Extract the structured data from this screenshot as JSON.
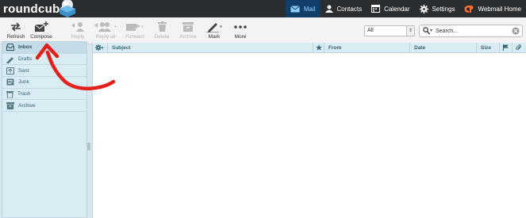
{
  "app": {
    "logo_text": "roundcube"
  },
  "topnav": {
    "items": [
      {
        "label": "Mail",
        "icon": "mail-icon"
      },
      {
        "label": "Contacts",
        "icon": "contacts-icon"
      },
      {
        "label": "Calendar",
        "icon": "calendar-icon"
      },
      {
        "label": "Settings",
        "icon": "gear-icon"
      },
      {
        "label": "Webmail Home",
        "icon": "cpanel-icon"
      }
    ],
    "active": "Mail"
  },
  "toolbar": {
    "buttons": [
      {
        "label": "Refresh",
        "icon": "refresh-icon",
        "enabled": true
      },
      {
        "label": "Compose",
        "icon": "compose-icon",
        "enabled": true
      },
      {
        "label": "Reply",
        "icon": "reply-icon",
        "enabled": false
      },
      {
        "label": "Reply all",
        "icon": "reply-all-icon",
        "enabled": false
      },
      {
        "label": "Forward",
        "icon": "forward-icon",
        "enabled": false
      },
      {
        "label": "Delete",
        "icon": "trash-icon",
        "enabled": false
      },
      {
        "label": "Archive",
        "icon": "archive-icon",
        "enabled": false
      },
      {
        "label": "Mark",
        "icon": "pencil-icon",
        "enabled": true
      },
      {
        "label": "More",
        "icon": "more-icon",
        "enabled": true
      }
    ]
  },
  "filter": {
    "selected": "All"
  },
  "search": {
    "placeholder": "Search..."
  },
  "folders": {
    "items": [
      {
        "label": "Inbox",
        "icon": "inbox-icon",
        "active": true
      },
      {
        "label": "Drafts",
        "icon": "pencil-icon",
        "active": false
      },
      {
        "label": "Sent",
        "icon": "sent-icon",
        "active": false
      },
      {
        "label": "Junk",
        "icon": "junk-icon",
        "active": false
      },
      {
        "label": "Trash",
        "icon": "trash-icon",
        "active": false
      },
      {
        "label": "Archive",
        "icon": "archive-icon",
        "active": false
      }
    ]
  },
  "message_list": {
    "columns": {
      "subject": "Subject",
      "from": "From",
      "date": "Date",
      "size": "Size"
    },
    "rows": []
  },
  "colors": {
    "topbar": "#2a2e31",
    "active_nav": "#123e6a",
    "folder_bg": "#d9ebf3",
    "annotation_arrow": "#e3211c"
  }
}
